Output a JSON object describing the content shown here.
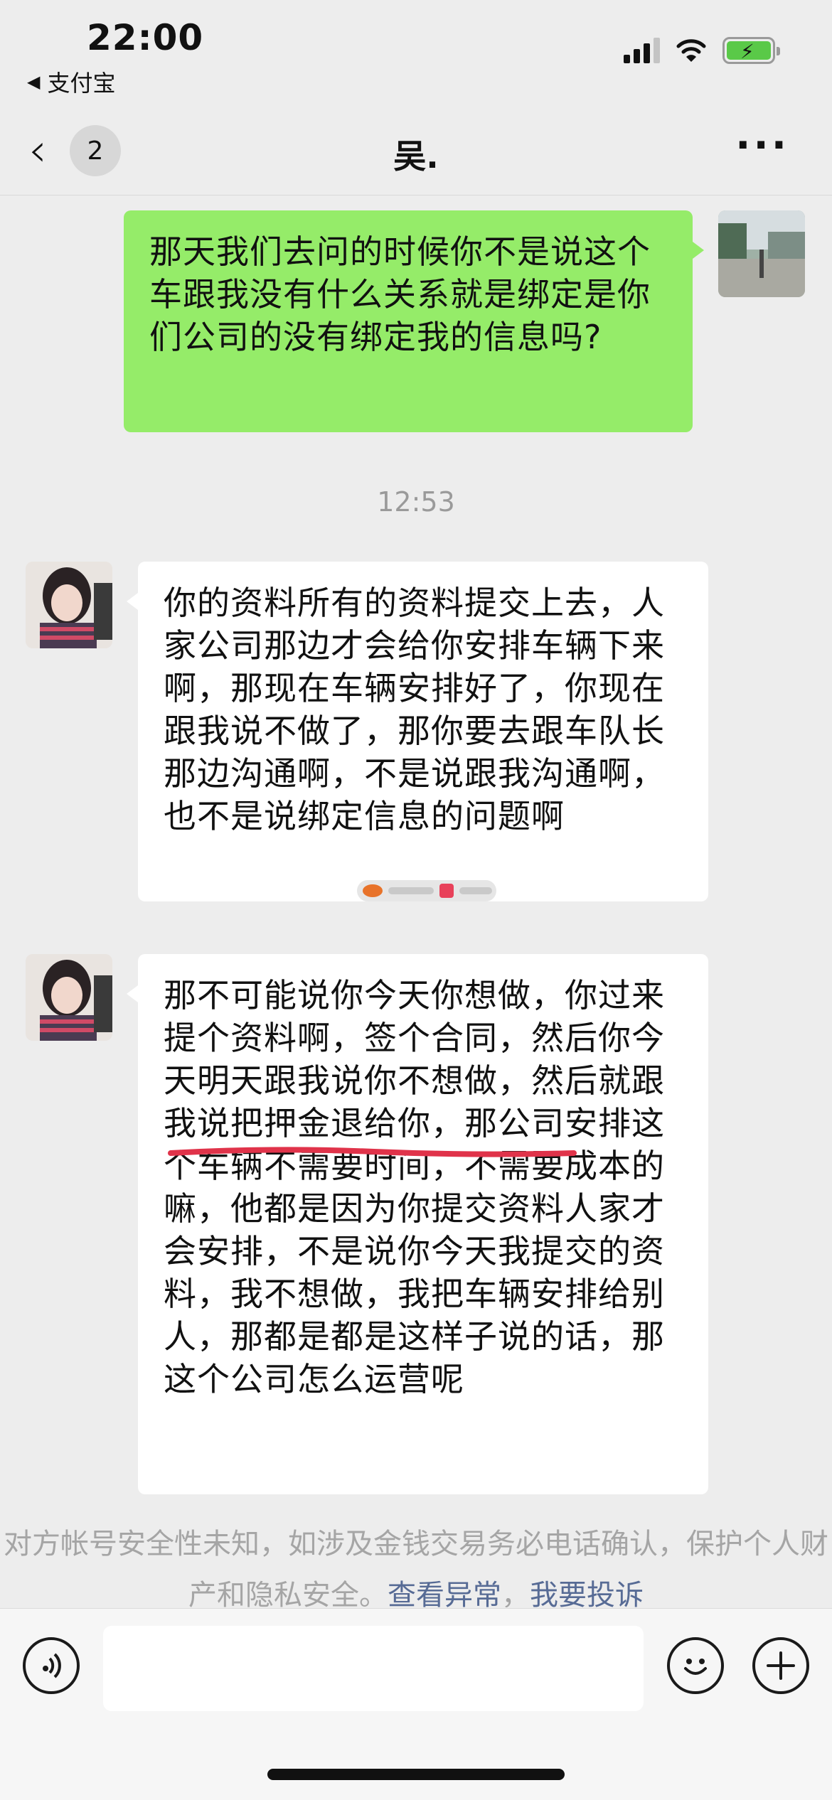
{
  "status_bar": {
    "time": "22:00",
    "back_app": "支付宝",
    "icons": [
      "signal-icon",
      "wifi-icon",
      "battery-charging-icon"
    ]
  },
  "header": {
    "unread_count": "2",
    "title": "吴.",
    "icons": [
      "back-chevron-icon",
      "more-icon"
    ]
  },
  "messages": [
    {
      "direction": "outgoing",
      "text": "那天我们去问的时候你不是说这个车跟我没有什么关系就是绑定是你们公司的没有绑定我的信息吗?"
    },
    {
      "direction": "timestamp",
      "text": "12:53"
    },
    {
      "direction": "incoming",
      "text": "你的资料所有的资料提交上去，人家公司那边才会给你安排车辆下来啊，那现在车辆安排好了，你现在跟我说不做了，那你要去跟车队长那边沟通啊，不是说跟我沟通啊，也不是说绑定信息的问题啊"
    },
    {
      "direction": "incoming",
      "text": "那不可能说你今天你想做，你过来提个资料啊，签个合同，然后你今天明天跟我说你不想做，然后就跟我说把押金退给你，那公司安排这个车辆不需要时间，不需要成本的嘛，他都是因为你提交资料人家才会安排，不是说你今天我提交的资料，我不想做，我把车辆安排给别人，那都是都是这样子说的话，那这个公司怎么运营呢"
    }
  ],
  "notice": {
    "text": "对方帐号安全性未知，如涉及金钱交易务必电话确认，保护个人财产和隐私安全。",
    "link_abnormal": "查看异常",
    "separator": "，",
    "link_complain": "我要投诉"
  },
  "input_bar": {
    "icons": [
      "voice-icon",
      "emoji-icon",
      "plus-icon"
    ],
    "input_value": ""
  },
  "colors": {
    "outgoing_bubble": "#95ec69",
    "incoming_bubble": "#ffffff",
    "background": "#ededed",
    "link": "#576b95"
  }
}
